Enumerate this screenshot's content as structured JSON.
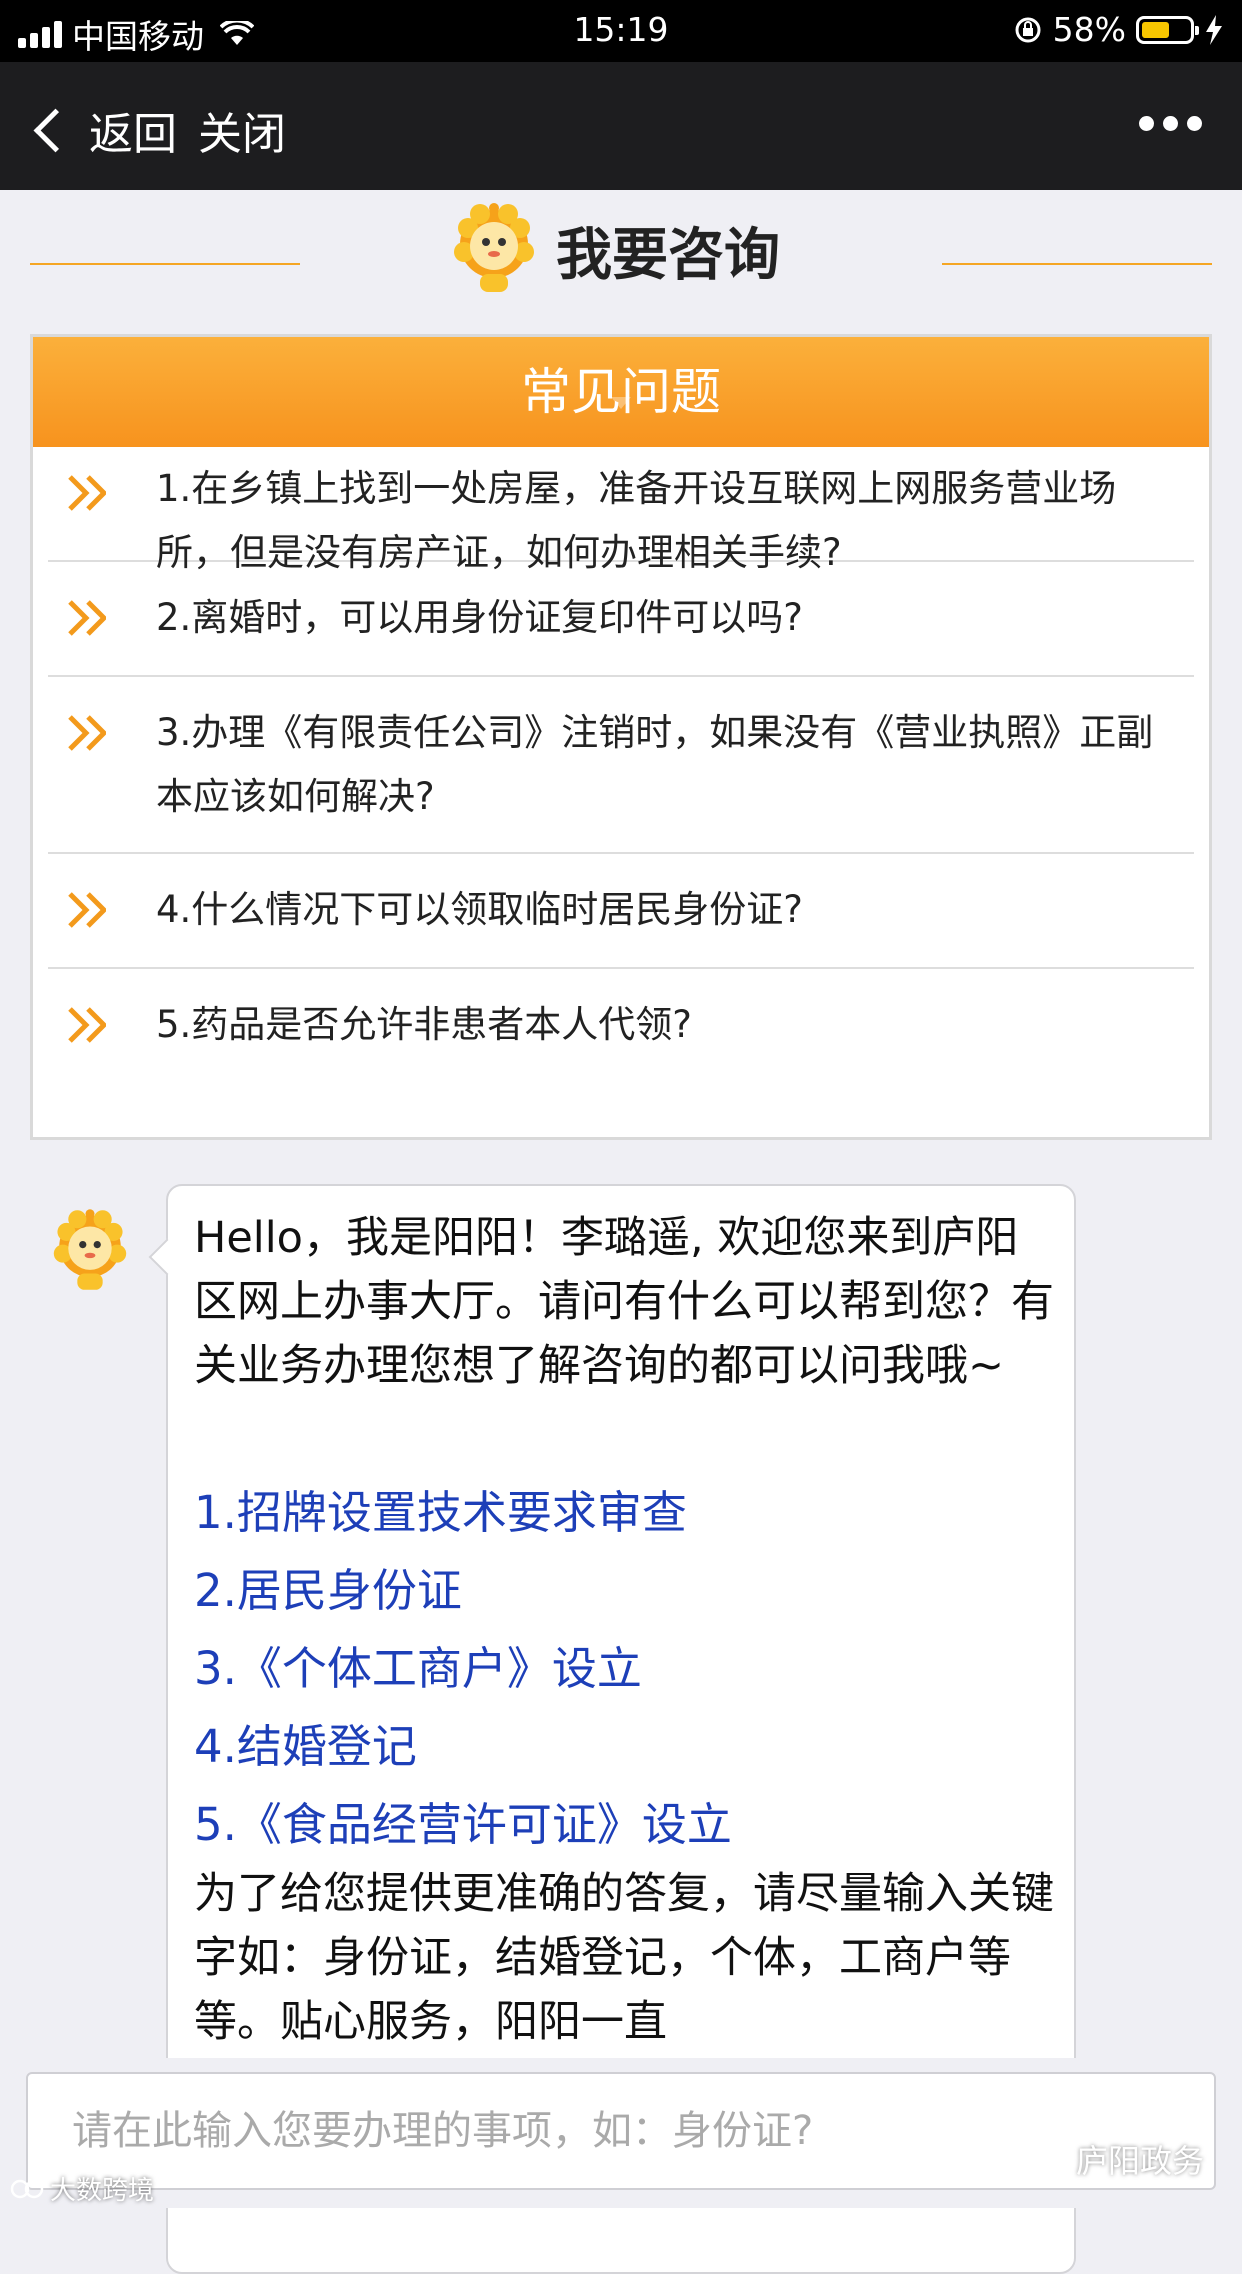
{
  "status": {
    "carrier": "中国移动",
    "time": "15:19",
    "battery": "58%",
    "battery_level": 0.58
  },
  "nav": {
    "back_label": "返回",
    "close_label": "关闭"
  },
  "page": {
    "title": "我要咨询"
  },
  "faq": {
    "header": "常见问题",
    "items": [
      {
        "text": "1.在乡镇上找到一处房屋，准备开设互联网上网服务营业场所，但是没有房产证，如何办理相关手续?"
      },
      {
        "text": "2.离婚时，可以用身份证复印件可以吗?"
      },
      {
        "text": "3.办理《有限责任公司》注销时，如果没有《营业执照》正副本应该如何解决?"
      },
      {
        "text": "4.什么情况下可以领取临时居民身份证?"
      },
      {
        "text": "5.药品是否允许非患者本人代领?"
      }
    ]
  },
  "chat": {
    "greeting": "Hello，我是阳阳！李璐遥, 欢迎您来到庐阳区网上办事大厅。请问有什么可以帮到您？有关业务办理您想了解咨询的都可以问我哦~",
    "topics": [
      "1.招牌设置技术要求审查",
      "2.居民身份证",
      "3.《个体工商户》设立",
      "4.结婚登记",
      "5.《食品经营许可证》设立"
    ],
    "hint": "为了给您提供更准确的答复，请尽量输入关键字如：身份证，结婚登记，个体，工商户等等。贴心服务，阳阳一直"
  },
  "input": {
    "placeholder": "请在此输入您要办理的事项，如：身份证?"
  },
  "watermarks": {
    "right": "庐阳政务",
    "left": "大数跨境"
  },
  "colors": {
    "accent_orange": "#f7931e",
    "link_blue": "#1d3fb8",
    "nav_bg": "#1d1d1f"
  }
}
